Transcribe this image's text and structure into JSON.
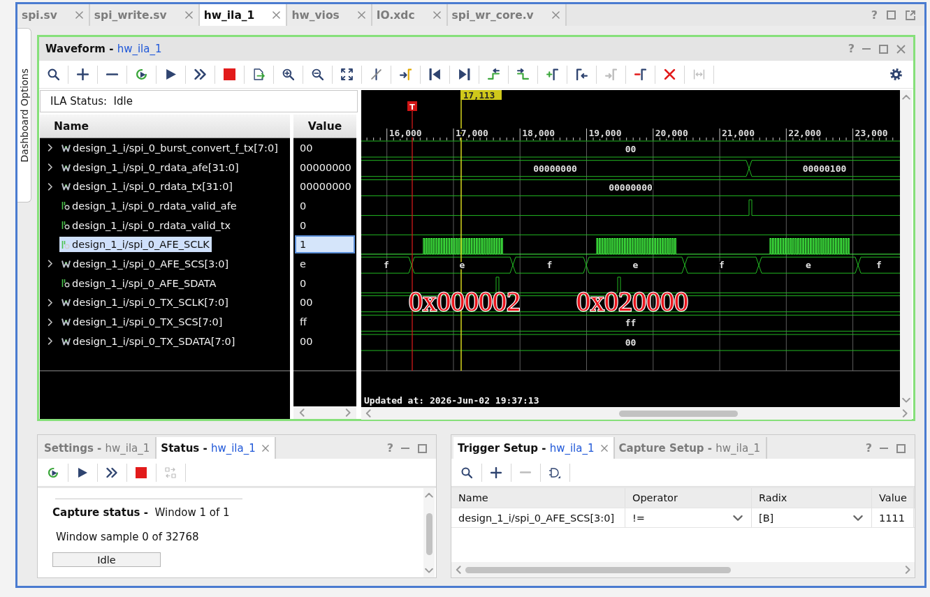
{
  "editor_tabs": {
    "help": "?",
    "tabs": [
      {
        "label": "spi.sv",
        "selected": false
      },
      {
        "label": "spi_write.sv",
        "selected": false
      },
      {
        "label": "hw_ila_1",
        "selected": true
      },
      {
        "label": "hw_vios",
        "selected": false
      },
      {
        "label": "IO.xdc",
        "selected": false
      },
      {
        "label": "spi_wr_core.v",
        "selected": false
      }
    ]
  },
  "side_tab": {
    "label": "Dashboard Options"
  },
  "waveform": {
    "title": "Waveform -",
    "target": "hw_ila_1",
    "help": "?",
    "toolbar": [
      {
        "kind": "search",
        "disabled": false
      },
      {
        "kind": "add",
        "disabled": false
      },
      {
        "kind": "remove",
        "disabled": false
      },
      {
        "kind": "autorun",
        "disabled": false
      },
      {
        "kind": "run",
        "disabled": false
      },
      {
        "kind": "immediate",
        "disabled": false
      },
      {
        "kind": "stop",
        "disabled": false
      },
      {
        "kind": "export",
        "disabled": false
      },
      {
        "kind": "zoomin",
        "disabled": false
      },
      {
        "kind": "zoomout",
        "disabled": false
      },
      {
        "kind": "zoomfit",
        "disabled": false
      },
      {
        "kind": "cursor",
        "disabled": false
      },
      {
        "kind": "gotocursor",
        "disabled": false
      },
      {
        "kind": "first",
        "disabled": false
      },
      {
        "kind": "last",
        "disabled": false
      },
      {
        "kind": "prevedge",
        "disabled": false
      },
      {
        "kind": "nextedge",
        "disabled": false
      },
      {
        "kind": "addmarker",
        "disabled": false
      },
      {
        "kind": "prevmarker",
        "disabled": false
      },
      {
        "kind": "nextmarker",
        "disabled": true
      },
      {
        "kind": "delmarker",
        "disabled": false
      },
      {
        "kind": "clearmarkers",
        "disabled": false
      },
      {
        "kind": "swapmarkers",
        "disabled": true
      },
      {
        "kind": "settings",
        "disabled": false
      }
    ],
    "ila_status": {
      "label": "ILA Status:",
      "value": "Idle"
    },
    "columns": [
      "Name",
      "Value"
    ],
    "signals": [
      {
        "kind": "bus",
        "expanded": false,
        "name": "design_1_i/spi_0_burst_convert_f_tx[7:0]",
        "value": "00",
        "selected": false,
        "wave_labels": [
          "00"
        ]
      },
      {
        "kind": "bus",
        "expanded": false,
        "name": "design_1_i/spi_0_rdata_afe[31:0]",
        "value": "00000000",
        "selected": false,
        "wave_labels": [
          "00000000",
          "00000100"
        ]
      },
      {
        "kind": "bus",
        "expanded": false,
        "name": "design_1_i/spi_0_rdata_tx[31:0]",
        "value": "00000000",
        "selected": false,
        "wave_labels": [
          "00000000"
        ]
      },
      {
        "kind": "bit",
        "name": "design_1_i/spi_0_rdata_valid_afe",
        "value": "0",
        "selected": false
      },
      {
        "kind": "bit",
        "name": "design_1_i/spi_0_rdata_valid_tx",
        "value": "0",
        "selected": false
      },
      {
        "kind": "bit",
        "name": "design_1_i/spi_0_AFE_SCLK",
        "value": "1",
        "selected": true
      },
      {
        "kind": "bus",
        "expanded": false,
        "name": "design_1_i/spi_0_AFE_SCS[3:0]",
        "value": "e",
        "selected": false,
        "wave_labels": [
          "f",
          "e",
          "f",
          "e",
          "f",
          "e",
          "f"
        ]
      },
      {
        "kind": "bit",
        "name": "design_1_i/spi_0_AFE_SDATA",
        "value": "0",
        "selected": false
      },
      {
        "kind": "bus",
        "expanded": false,
        "name": "design_1_i/spi_0_TX_SCLK[7:0]",
        "value": "00",
        "selected": false
      },
      {
        "kind": "bus",
        "expanded": false,
        "name": "design_1_i/spi_0_TX_SCS[7:0]",
        "value": "ff",
        "selected": false,
        "wave_labels": [
          "ff"
        ]
      },
      {
        "kind": "bus",
        "expanded": false,
        "name": "design_1_i/spi_0_TX_SDATA[7:0]",
        "value": "00",
        "selected": false,
        "wave_labels": [
          "00"
        ]
      }
    ],
    "cursor_label": "17,113",
    "trigger_label": "T",
    "ticks": [
      "16,000",
      "17,000",
      "18,000",
      "19,000",
      "20,000",
      "21,000",
      "22,000",
      "23,000"
    ],
    "annotations": [
      "0x000002",
      "0x020000"
    ],
    "updated": "Updated at: 2026-Jun-02 19:37:13"
  },
  "status_panel": {
    "help": "?",
    "tabs": [
      {
        "label": "Settings -",
        "target": "hw_ila_1",
        "selected": false
      },
      {
        "label": "Status -",
        "target": "hw_ila_1",
        "selected": true
      }
    ],
    "toolbar": [
      {
        "kind": "autorun",
        "disabled": false
      },
      {
        "kind": "run",
        "disabled": false
      },
      {
        "kind": "immediate",
        "disabled": false
      },
      {
        "kind": "stop",
        "disabled": false
      },
      {
        "kind": "swap",
        "disabled": true
      }
    ],
    "capture_status": {
      "label": "Capture status -",
      "value": "Window 1 of 1"
    },
    "sample": "Window sample 0 of 32768",
    "state": "Idle"
  },
  "trigger_panel": {
    "help": "?",
    "tabs": [
      {
        "label": "Trigger Setup -",
        "target": "hw_ila_1",
        "selected": true
      },
      {
        "label": "Capture Setup -",
        "target": "hw_ila_1",
        "selected": false
      }
    ],
    "toolbar": [
      {
        "kind": "search",
        "disabled": false
      },
      {
        "kind": "add",
        "disabled": false
      },
      {
        "kind": "remove",
        "disabled": true
      },
      {
        "kind": "gate",
        "disabled": false
      }
    ],
    "columns": [
      "Name",
      "Operator",
      "Radix",
      "Value"
    ],
    "rows": [
      {
        "name": "design_1_i/spi_0_AFE_SCS[3:0]",
        "operator": "!=",
        "radix": "[B]",
        "value": "1111"
      }
    ]
  }
}
